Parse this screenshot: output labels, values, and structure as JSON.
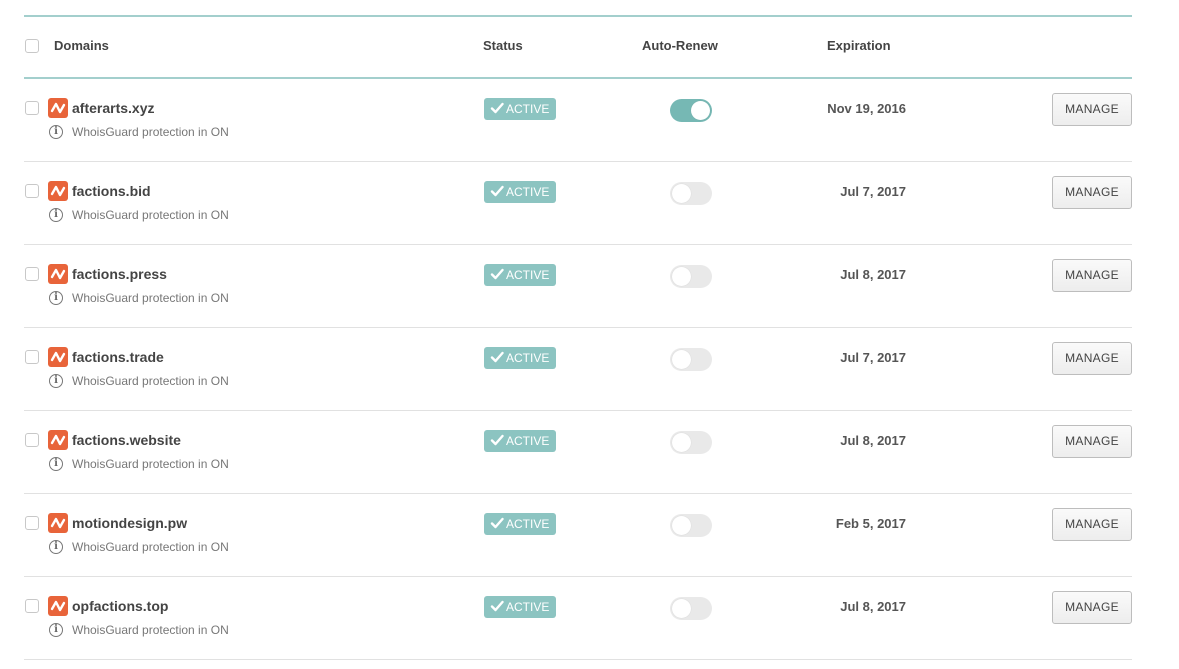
{
  "table": {
    "headers": {
      "domains": "Domains",
      "status": "Status",
      "auto_renew": "Auto-Renew",
      "expiration": "Expiration"
    },
    "rows": [
      {
        "domain": "afterarts.xyz",
        "whois": "WhoisGuard protection in ON",
        "status": "ACTIVE",
        "auto_renew": true,
        "expiration": "Nov 19, 2016",
        "action": "MANAGE"
      },
      {
        "domain": "factions.bid",
        "whois": "WhoisGuard protection in ON",
        "status": "ACTIVE",
        "auto_renew": false,
        "expiration": "Jul 7, 2017",
        "action": "MANAGE"
      },
      {
        "domain": "factions.press",
        "whois": "WhoisGuard protection in ON",
        "status": "ACTIVE",
        "auto_renew": false,
        "expiration": "Jul 8, 2017",
        "action": "MANAGE"
      },
      {
        "domain": "factions.trade",
        "whois": "WhoisGuard protection in ON",
        "status": "ACTIVE",
        "auto_renew": false,
        "expiration": "Jul 7, 2017",
        "action": "MANAGE"
      },
      {
        "domain": "factions.website",
        "whois": "WhoisGuard protection in ON",
        "status": "ACTIVE",
        "auto_renew": false,
        "expiration": "Jul 8, 2017",
        "action": "MANAGE"
      },
      {
        "domain": "motiondesign.pw",
        "whois": "WhoisGuard protection in ON",
        "status": "ACTIVE",
        "auto_renew": false,
        "expiration": "Feb 5, 2017",
        "action": "MANAGE"
      },
      {
        "domain": "opfactions.top",
        "whois": "WhoisGuard protection in ON",
        "status": "ACTIVE",
        "auto_renew": false,
        "expiration": "Jul 8, 2017",
        "action": "MANAGE"
      }
    ]
  },
  "icons": {
    "logo": "namecheap-logo-icon",
    "info": "info-icon",
    "check": "check-icon"
  },
  "colors": {
    "accent": "#8cc4c1",
    "toggle_on": "#76b8b4",
    "logo": "#e8643a",
    "rule": "#a3cfcd"
  }
}
